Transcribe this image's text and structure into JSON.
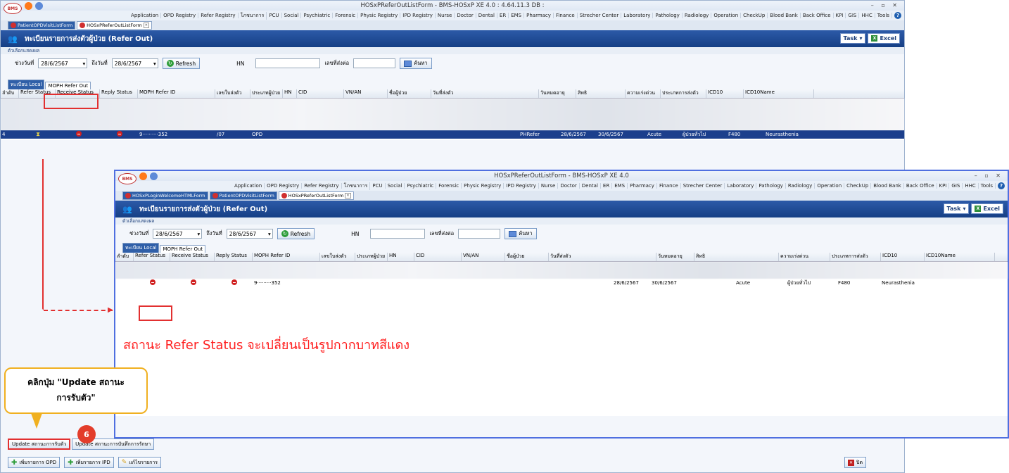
{
  "main_window": {
    "title": "HOSxPReferOutListForm - BMS-HOSxP XE 4.0 : 4.64.11.3 DB :",
    "menu": [
      "Application",
      "OPD Registry",
      "Refer Registry",
      "โภชนาการ",
      "PCU",
      "Social",
      "Psychiatric",
      "Forensic",
      "Physic Registry",
      "IPD Registry",
      "Nurse",
      "Doctor",
      "Dental",
      "ER",
      "EMS",
      "Pharmacy",
      "Finance",
      "Strecher Center",
      "Laboratory",
      "Pathology",
      "Radiology",
      "Operation",
      "CheckUp",
      "Blood Bank",
      "Back Office",
      "KPI",
      "GIS",
      "HHC",
      "Tools"
    ],
    "doc_tabs": [
      "PatientOPDVisitListForm",
      "HOSxPReferOutListForm"
    ],
    "form_title": "ทะเบียนรายการส่งตัวผู้ป่วย (Refer Out)",
    "task_label": "Task",
    "excel_label": "Excel",
    "options_label": "ตัวเลือกแสดงผล",
    "filter": {
      "from_label": "ช่วงวันที่",
      "from_value": "28/6/2567",
      "to_label": "ถึงวันที่",
      "to_value": "28/6/2567",
      "refresh_label": "Refresh",
      "hn_label": "HN",
      "refer_no_label": "เลขที่ส่งต่อ",
      "search_label": "ค้นหา"
    },
    "sub_tabs": [
      "ทะเบียน Local",
      "MOPH Refer Out"
    ],
    "columns": [
      "ลำดับ",
      "Refer Status",
      "Receive Status",
      "Reply Status",
      "MOPH Refer ID",
      "เลขใบส่งตัว",
      "ประเภทผู้ป่วย",
      "HN",
      "CID",
      "VN/AN",
      "ชื่อผู้ป่วย",
      "วันที่ส่งตัว",
      "วันหมดอายุ",
      "สิทธิ",
      "ความเร่งด่วน",
      "ประเภทการส่งตัว",
      "ICD10",
      "ICD10Name"
    ],
    "selected_row": {
      "no": "4",
      "refer_id": "9",
      "refer_id_tail": "352",
      "refer_doc": "/07",
      "patient_type": "OPD",
      "name_tail": "PHRefer",
      "refer_date": "28/6/2567",
      "expire_date": "30/6/2567",
      "urgency": "Acute",
      "refer_type": "ผู้ป่วยทั่วไป",
      "icd10": "F480",
      "icd10name": "Neurasthenia"
    },
    "bottom_buttons": [
      "Update สถานะการรับตัว",
      "Update สถานะการบันทึกการรักษา"
    ],
    "footer_buttons": [
      "เพิ่มรายการ OPD",
      "เพิ่มรายการ IPD",
      "แก้ไขรายการ"
    ],
    "close_label": "ปิด"
  },
  "inset_window": {
    "title": "HOSxPReferOutListForm - BMS-HOSxP XE 4.0",
    "doc_tabs": [
      "HOSxPLoginWelcomeHTMLForm",
      "PatientOPDVisitListForm",
      "HOSxPReferOutListForm"
    ],
    "row": {
      "refer_id": "9",
      "refer_id_tail": "352",
      "refer_date": "28/6/2567",
      "expire_date": "30/6/2567",
      "urgency": "Acute",
      "refer_type": "ผู้ป่วยทั่วไป",
      "icd10": "F480",
      "icd10name": "Neurasthenia"
    }
  },
  "annotations": {
    "caption": "สถานะ Refer Status จะเปลี่ยนเป็นรูปกากบาทสีแดง",
    "callout_line1": "คลิกปุ่ม \"Update สถานะ",
    "callout_line2": "การรับตัว\"",
    "step_number": "6",
    "accent_red": "#e23030",
    "accent_blue": "#1c3f8c"
  }
}
